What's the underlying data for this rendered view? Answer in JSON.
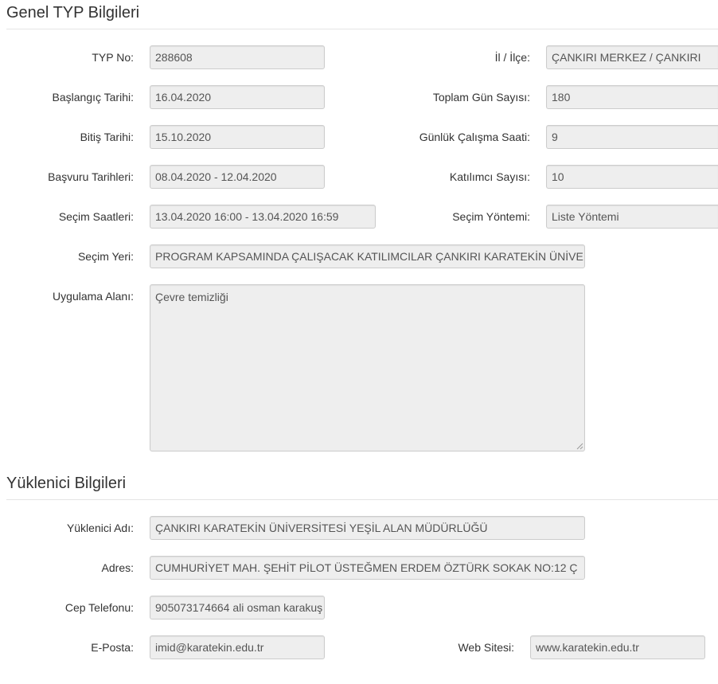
{
  "genel": {
    "title": "Genel TYP Bilgileri",
    "typ_no": {
      "label": "TYP No:",
      "value": "288608"
    },
    "il_ilce": {
      "label": "İl / İlçe:",
      "value": "ÇANKIRI MERKEZ / ÇANKIRI"
    },
    "baslangic": {
      "label": "Başlangıç Tarihi:",
      "value": "16.04.2020"
    },
    "toplam_gun": {
      "label": "Toplam Gün Sayısı:",
      "value": "180"
    },
    "bitis": {
      "label": "Bitiş Tarihi:",
      "value": "15.10.2020"
    },
    "gunluk_saat": {
      "label": "Günlük Çalışma Saati:",
      "value": "9"
    },
    "basvuru": {
      "label": "Başvuru Tarihleri:",
      "value": "08.04.2020 - 12.04.2020"
    },
    "katilimci": {
      "label": "Katılımcı Sayısı:",
      "value": "10"
    },
    "secim_saatleri": {
      "label": "Seçim Saatleri:",
      "value": "13.04.2020 16:00 - 13.04.2020 16:59"
    },
    "secim_yontemi": {
      "label": "Seçim Yöntemi:",
      "value": "Liste Yöntemi"
    },
    "secim_yeri": {
      "label": "Seçim Yeri:",
      "value": "PROGRAM KAPSAMINDA ÇALIŞACAK KATILIMCILAR ÇANKIRI KARATEKİN ÜNİVE"
    },
    "uygulama_alani": {
      "label": "Uygulama Alanı:",
      "value": "Çevre temizliği"
    }
  },
  "yuklenici": {
    "title": "Yüklenici Bilgileri",
    "adi": {
      "label": "Yüklenici Adı:",
      "value": "ÇANKIRI KARATEKİN ÜNİVERSİTESİ YEŞİL ALAN MÜDÜRLÜĞÜ"
    },
    "adres": {
      "label": "Adres:",
      "value": "CUMHURİYET MAH. ŞEHİT PİLOT ÜSTEĞMEN ERDEM ÖZTÜRK SOKAK NO:12  Ç"
    },
    "cep_telefonu": {
      "label": "Cep Telefonu:",
      "value": "905073174664 ali osman karakuş"
    },
    "eposta": {
      "label": "E-Posta:",
      "value": "imid@karatekin.edu.tr"
    },
    "web_sitesi": {
      "label": "Web Sitesi:",
      "value": "www.karatekin.edu.tr"
    }
  },
  "colors": {
    "field_bg": "#eeeeee",
    "field_border": "#cccccc",
    "text": "#333333",
    "field_text": "#555555"
  }
}
